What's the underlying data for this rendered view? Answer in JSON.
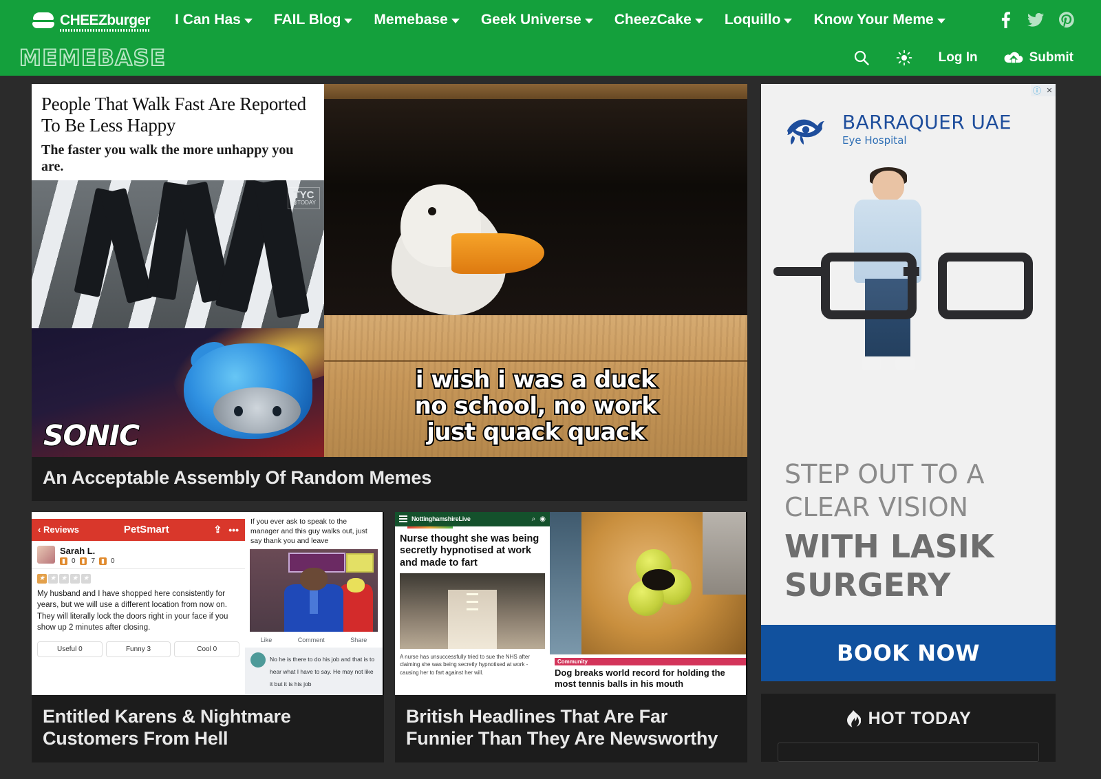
{
  "site": {
    "network_logo": "CHEEZburger",
    "network_logo_upper": "CHEEZ",
    "network_logo_lower": "burger",
    "brand": "MEMEBASE",
    "brand_color": "#14a03c"
  },
  "nav": {
    "items": [
      {
        "label": "I Can Has",
        "has_dropdown": true
      },
      {
        "label": "FAIL Blog",
        "has_dropdown": true
      },
      {
        "label": "Memebase",
        "has_dropdown": true
      },
      {
        "label": "Geek Universe",
        "has_dropdown": true
      },
      {
        "label": "CheezCake",
        "has_dropdown": true
      },
      {
        "label": "Loquillo",
        "has_dropdown": true
      },
      {
        "label": "Know Your Meme",
        "has_dropdown": true
      }
    ],
    "social": [
      "facebook-icon",
      "twitter-icon",
      "pinterest-icon"
    ]
  },
  "tools": {
    "search": "search-icon",
    "theme": "sun-icon",
    "login_label": "Log In",
    "submit_label": "Submit",
    "submit_icon": "upload-cloud-icon"
  },
  "posts": [
    {
      "title": "An Acceptable Assembly Of Random Memes",
      "tiles": {
        "news": {
          "headline": "People That Walk Fast Are Reported To Be Less Happy",
          "subhead": "The faster you walk the more unhappy you are.",
          "watermark": "TYC",
          "watermark_sub": "@TODAY"
        },
        "duck": {
          "caption_line_1": "i wish i was a duck",
          "caption_line_2": "no school, no work",
          "caption_line_3": "just quack quack"
        },
        "sonic": {
          "wordmark": "SONIC"
        }
      }
    },
    {
      "title": "Entitled Karens & Nightmare Customers From Hell",
      "review": {
        "back_label": "Reviews",
        "business": "PetSmart",
        "share_icon": "share-icon",
        "more_icon": "more-icon",
        "reviewer": "Sarah L.",
        "stats": [
          "0",
          "7",
          "0"
        ],
        "rating": 1,
        "max_rating": 5,
        "body": "My husband and I have shopped here consistently for years, but we will use a different location from now on. They will literally lock the doors right in your face if you show up 2 minutes after closing.",
        "actions": [
          "Useful 0",
          "Funny 3",
          "Cool 0"
        ]
      },
      "manager": {
        "caption": "If you ever ask to speak to the manager and this guy walks out, just say thank you and leave",
        "actions": [
          "Like",
          "Comment",
          "Share"
        ],
        "reply": "No he is there to do his job and that is to hear what I have to say. He may not like it but it is his job"
      }
    },
    {
      "title": "British Headlines That Are Far Funnier Than They Are Newsworthy",
      "notts": {
        "brand": "NottinghamshireLive",
        "menu_icon": "hamburger-icon",
        "search_icon": "search-icon",
        "headline": "Nurse thought she was being secretly hypnotised at work and made to fart",
        "standfirst": "A nurse has unsuccessfully tried to sue the NHS after claiming she was being secretly hypnotised at work - causing her to fart against her will."
      },
      "dog": {
        "badge": "Community",
        "headline": "Dog breaks world record for holding the most tennis balls in his mouth"
      }
    }
  ],
  "ad": {
    "info_icon": "info-icon",
    "close_icon": "close-icon",
    "brand_name": "BARRAQUER UAE",
    "brand_sub": "Eye Hospital",
    "headline_light": "STEP OUT TO A CLEAR VISION",
    "headline_bold": "WITH LASIK SURGERY",
    "cta": "BOOK NOW",
    "cta_color": "#11519e",
    "brand_color": "#1f4e9c"
  },
  "sidebar": {
    "hot_today_label": "HOT TODAY",
    "hot_today_icon": "flame-icon"
  }
}
